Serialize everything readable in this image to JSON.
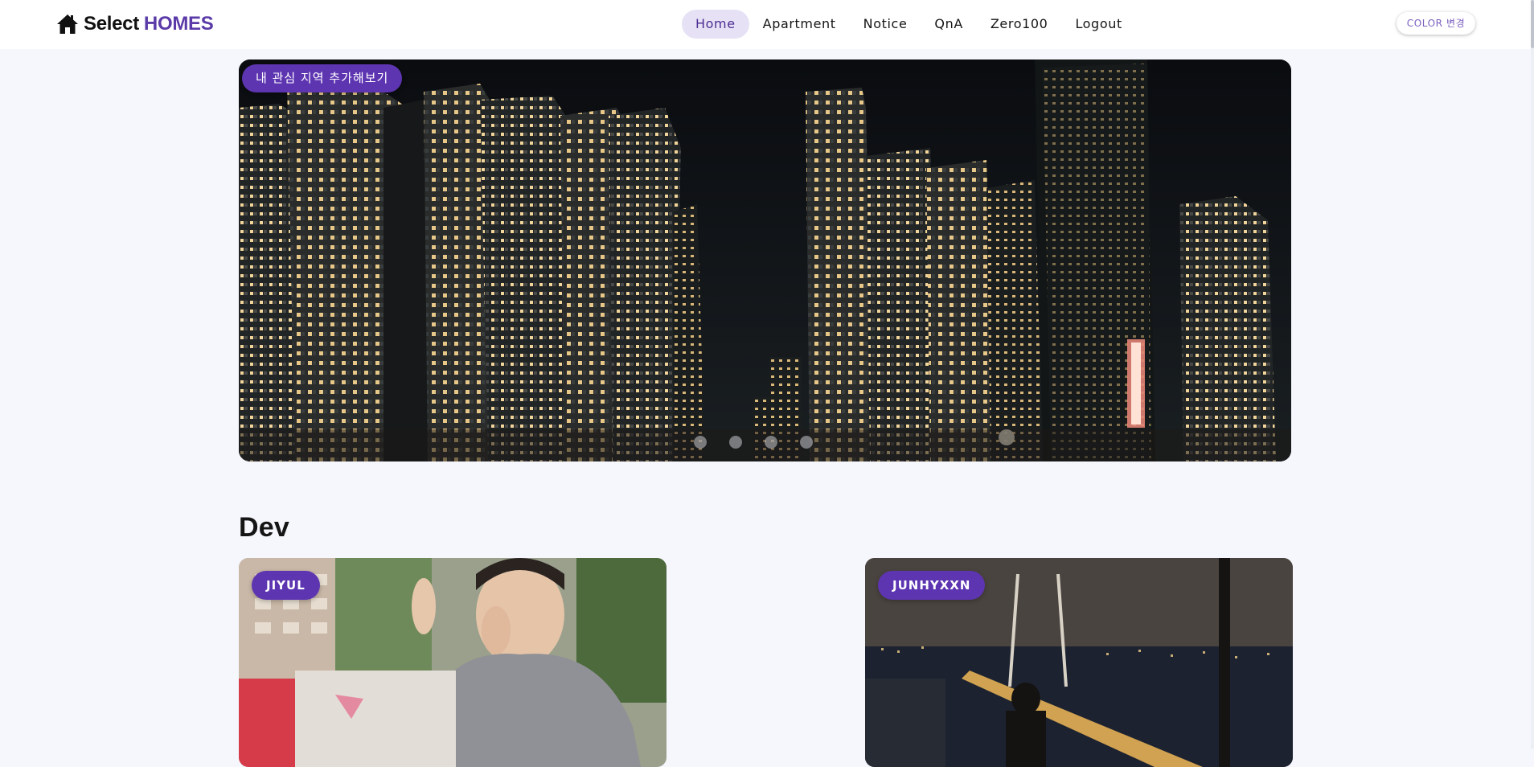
{
  "brand": {
    "name_prefix": "Select",
    "name_accent": "HOMES",
    "icon": "home-icon"
  },
  "nav": {
    "items": [
      {
        "label": "Home",
        "active": true
      },
      {
        "label": "Apartment",
        "active": false
      },
      {
        "label": "Notice",
        "active": false
      },
      {
        "label": "QnA",
        "active": false
      },
      {
        "label": "Zero100",
        "active": false
      },
      {
        "label": "Logout",
        "active": false
      }
    ]
  },
  "color_button": {
    "label": "COLOR 변경"
  },
  "hero": {
    "badge": "내 관심 지역 추가해보기",
    "image": "night-city-apartments-photo",
    "slide_count": 4,
    "active_slide": 1
  },
  "dev_section": {
    "title": "Dev",
    "cards": [
      {
        "badge": "JIYUL",
        "image": "person-eating-outdoors-photo"
      },
      {
        "badge": "JUNHYXXN",
        "image": "night-bridge-city-view-photo"
      }
    ]
  },
  "colors": {
    "accent": "#5e35b1",
    "nav_active_bg": "#e7e1f5",
    "page_bg": "#f6f7fc"
  }
}
